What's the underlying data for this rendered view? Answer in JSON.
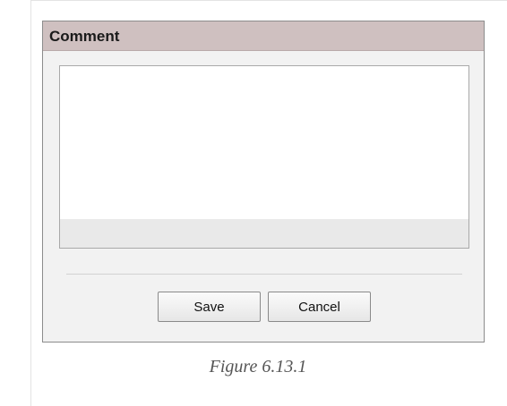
{
  "dialog": {
    "title": "Comment",
    "comment_value": "",
    "save_label": "Save",
    "cancel_label": "Cancel"
  },
  "caption": "Figure 6.13.1",
  "colors": {
    "header_bg": "#cfc0c0",
    "dialog_bg": "#f2f2f2",
    "caption_text": "#555555"
  }
}
